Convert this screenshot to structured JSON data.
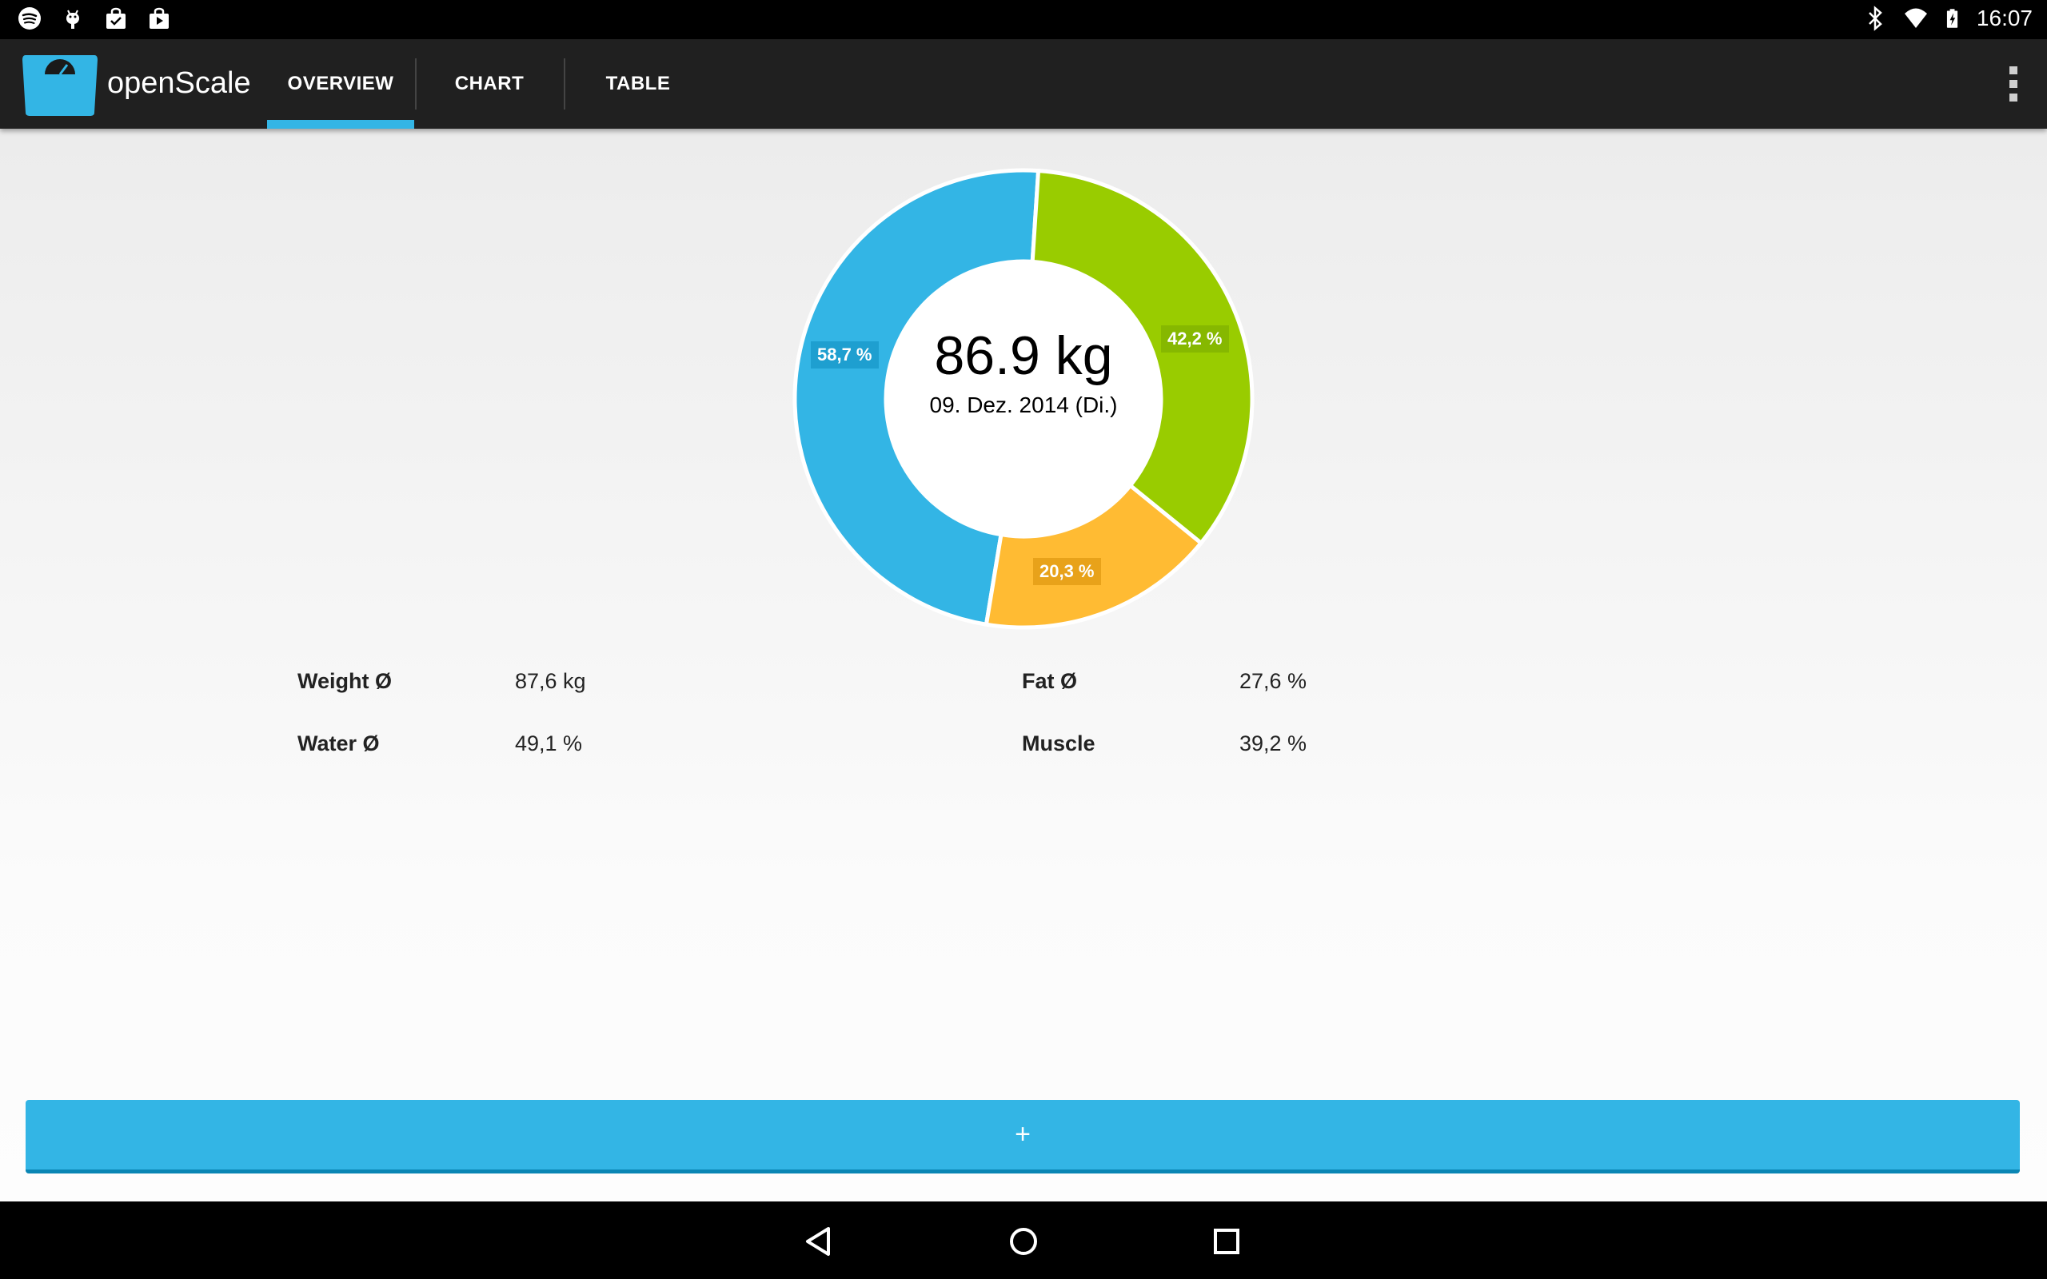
{
  "status_bar": {
    "time": "16:07",
    "left_icons": [
      "spotify-icon",
      "android-debug-icon",
      "store-bag-icon",
      "play-store-icon"
    ],
    "right_icons": [
      "bluetooth-icon",
      "wifi-icon",
      "battery-charging-icon"
    ]
  },
  "action_bar": {
    "app_title": "openScale",
    "tabs": [
      {
        "label": "OVERVIEW",
        "selected": true
      },
      {
        "label": "CHART",
        "selected": false
      },
      {
        "label": "TABLE",
        "selected": false
      }
    ]
  },
  "overview": {
    "center_value": "86.9 kg",
    "center_date": "09. Dez. 2014 (Di.)",
    "stats": [
      {
        "label": "Weight Ø",
        "value": "87,6 kg"
      },
      {
        "label": "Fat Ø",
        "value": "27,6 %"
      },
      {
        "label": "Water Ø",
        "value": "49,1 %"
      },
      {
        "label": "Muscle",
        "value": "39,2 %"
      }
    ]
  },
  "chart_data": {
    "type": "pie",
    "categories": [
      "58,7 %",
      "42,2 %",
      "20,3 %"
    ],
    "values": [
      58.7,
      42.2,
      20.3
    ],
    "colors": [
      "#33b5e5",
      "#99cc00",
      "#ffbb33"
    ]
  },
  "add_button": {
    "label": "+"
  },
  "colors": {
    "accent": "#33b5e5",
    "action_bar": "#202020"
  }
}
